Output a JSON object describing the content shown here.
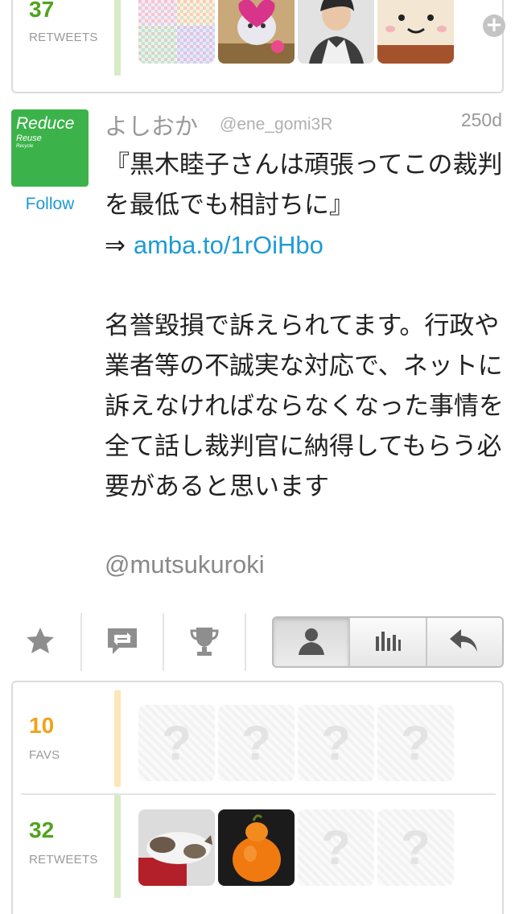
{
  "top_stats": {
    "retweets_count": "37",
    "retweets_label": "RETWEETS",
    "thumbs": [
      "check-pattern-thumb",
      "balloon-thumb",
      "person-thumb",
      "smiley-cake-thumb"
    ]
  },
  "tweet": {
    "avatar": {
      "line1": "Reduce",
      "line2": "Reuse",
      "line3": "Recycle"
    },
    "follow_label": "Follow",
    "name": "よしおか",
    "handle": "@ene_gomi3R",
    "age": "250d",
    "text_line1": "『黒木睦子さんは頑張ってこの裁判を最低でも相討ちに』",
    "arrow": "⇒ ",
    "link": "amba.to/1rOiHbo",
    "text_para2": "名誉毀損で訴えられてます。行政や業者等の不誠実な対応で、ネットに訴えなければならなくなった事情を全て話し裁判官に納得してもらう必要があると思います",
    "mention": "@mutsukuroki"
  },
  "actions": {
    "icons": [
      "star-icon",
      "retweet-icon",
      "trophy-icon"
    ],
    "segments": [
      "profile-icon",
      "stats-icon",
      "reply-icon"
    ]
  },
  "bottom_stats": {
    "favs_count": "10",
    "favs_label": "FAVS",
    "retweets_count": "32",
    "retweets_label": "RETWEETS"
  },
  "colors": {
    "green": "#4fa31e",
    "orange": "#f2a21b",
    "link": "#1d9ad6"
  }
}
